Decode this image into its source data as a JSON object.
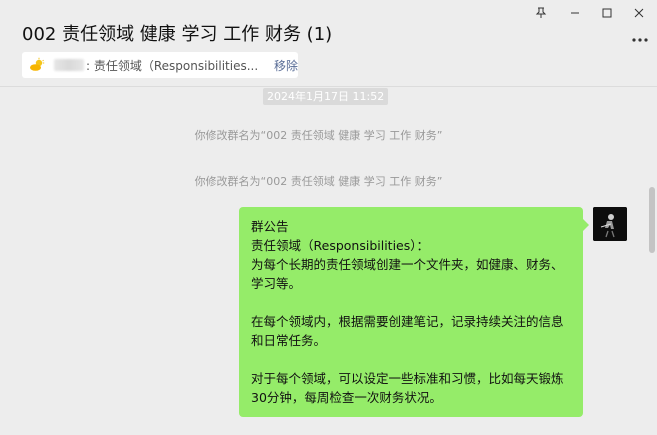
{
  "window": {
    "title": "002 责任领域 健康 学习 工作 财务 (1)",
    "controls": {
      "pin_icon": "pin-icon",
      "minimize_icon": "minimize-icon",
      "maximize_icon": "maximize-icon",
      "close_icon": "close-icon",
      "more_icon": "more-icon"
    }
  },
  "pinned": {
    "icon": "sun-cloud-icon",
    "text": ": 责任领域（Responsibilities...",
    "remove_label": "移除"
  },
  "messages": {
    "timestamp": "2024年1月17日 11:52",
    "system": [
      "你修改群名为“002 责任领域 健康 学习 工作 财务”",
      "你修改群名为“002 责任领域 健康 学习 工作 财务”"
    ],
    "bubble": {
      "line1": "群公告",
      "line2": "责任领域（Responsibilities）：",
      "line3": "为每个长期的责任领域创建一个文件夹，如健康、财务、学习等。",
      "line4": "在每个领域内，根据需要创建笔记，记录持续关注的信息和日常任务。",
      "line5": "对于每个领域，可以设定一些标准和习惯，比如每天锻炼30分钟，每周检查一次财务状况。"
    }
  },
  "colors": {
    "background": "#ededed",
    "bubble": "#95ec69",
    "link": "#576b95"
  }
}
